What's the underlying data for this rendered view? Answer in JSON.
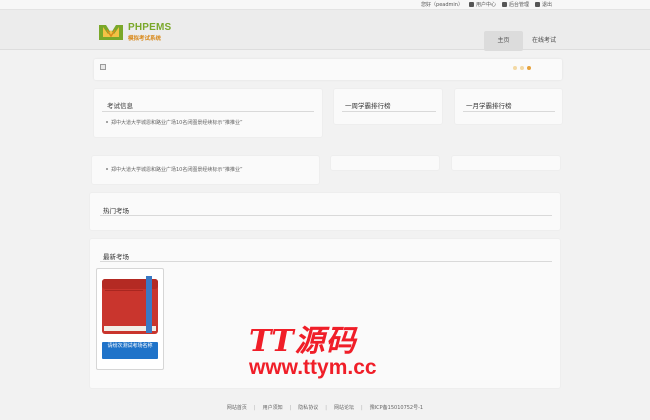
{
  "toplinks": {
    "greeting": "您好（peadmin）",
    "user_center": "用户中心",
    "admin": "后台管理",
    "logout": "退出"
  },
  "header": {
    "logo_title": "PHPEMS",
    "logo_subtitle": "模拟考试系统",
    "nav": [
      "主页",
      "在线考试"
    ]
  },
  "banner": {
    "slides": 3,
    "active_slide": 3
  },
  "sections": {
    "exam_info": "考试信息",
    "week_rank": "一周学霸排行榜",
    "month_rank": "一月学霸排行榜",
    "hot_exams": "热门考场",
    "new_exams": "最新考场"
  },
  "news": [
    "郑中大道大学城恩和路业广场10名闭图景经续标示“推推业”",
    "郑中大道大学城恩和路业广场10名闭图景经续标示“推推业”"
  ],
  "exam_card": {
    "button_label": "请纷次测试考场名称"
  },
  "watermark": {
    "line1": "TT源码",
    "line2": "www.ttym.cc"
  },
  "footer": [
    "网站首页",
    "用户须知",
    "隐私协议",
    "网站论坛",
    "豫ICP备15010752号-1"
  ],
  "colors": {
    "brand_green": "#7aa82a",
    "brand_orange": "#d98a1c",
    "button_blue": "#1f73c9",
    "watermark_red": "#f01e28"
  }
}
